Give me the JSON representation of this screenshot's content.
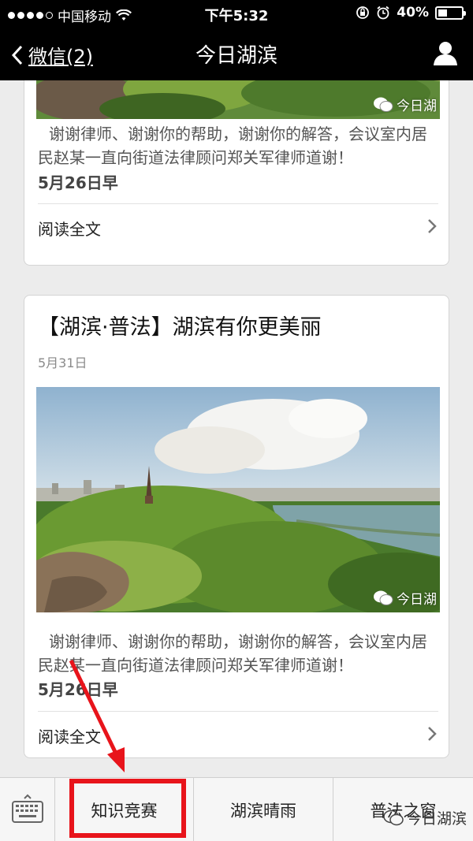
{
  "status_bar": {
    "carrier": "中国移动",
    "time": "下午5:32",
    "battery": "40%",
    "battery_level": 0.4
  },
  "nav": {
    "back_label": "微信(2)",
    "title": "今日湖滨"
  },
  "articles": [
    {
      "title": "",
      "image_watermark": "今日湖",
      "description": "谢谢律师、谢谢你的帮助，谢谢你的解答，会议室内居民赵某一直向街道法律顾问郑关军律师道谢！",
      "desc_date": "5月26日早",
      "read_more": "阅读全文"
    },
    {
      "title": "【湖滨·普法】湖滨有你更美丽",
      "date": "5月31日",
      "image_watermark": "今日湖",
      "description": "谢谢律师、谢谢你的帮助，谢谢你的解答，会议室内居民赵某一直向街道法律顾问郑关军律师道谢！",
      "desc_date": "5月26日早",
      "read_more": "阅读全文"
    }
  ],
  "bottom_menu": {
    "items": [
      "知识竞赛",
      "湖滨晴雨",
      "普法之窗"
    ],
    "highlighted_index": 0
  },
  "watermark": "今日湖滨",
  "colors": {
    "highlight": "#e8141b",
    "navbar": "#000000"
  }
}
